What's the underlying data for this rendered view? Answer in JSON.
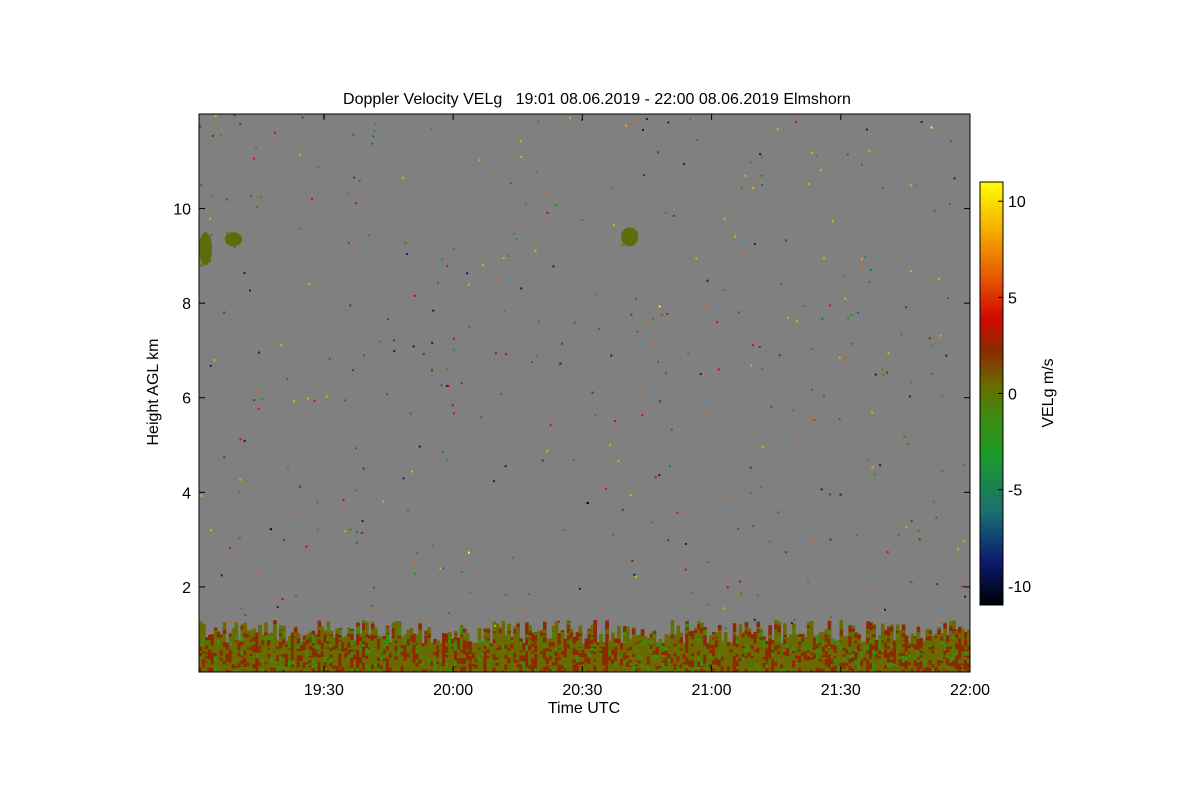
{
  "chart_data": {
    "type": "heatmap",
    "title": "Doppler Velocity VELg   19:01 08.06.2019 - 22:00 08.06.2019 Elmshorn",
    "xlabel": "Time UTC",
    "ylabel": "Height AGL km",
    "x_time_range": [
      "19:01",
      "22:00"
    ],
    "xticks": [
      "19:30",
      "20:00",
      "20:30",
      "21:00",
      "21:30",
      "22:00"
    ],
    "xtick_minutes": [
      30,
      60,
      90,
      120,
      150,
      180
    ],
    "ylim": [
      0.2,
      12.0
    ],
    "yticks": [
      2,
      4,
      6,
      8,
      10
    ],
    "colorbar": {
      "label": "VELg m/s",
      "range": [
        -11,
        11
      ],
      "ticks": [
        10,
        5,
        0,
        -5,
        -10
      ],
      "colors": [
        "#000000",
        "#0a1a6e",
        "#1b6e72",
        "#1a9a2a",
        "#3f8a10",
        "#6a6a00",
        "#8b2a00",
        "#d20a00",
        "#e85c00",
        "#f5a800",
        "#ffff00"
      ]
    },
    "background_color": "#808080",
    "features": [
      {
        "name": "boundary layer",
        "time_range": [
          "19:01",
          "22:00"
        ],
        "height_km": [
          0.2,
          1.3
        ],
        "velocity_m_s": [
          -2,
          3
        ]
      },
      {
        "name": "upper cloud",
        "time_range": [
          "19:01",
          "19:04"
        ],
        "height_km": [
          8.8,
          9.5
        ],
        "velocity_m_s": [
          -1,
          0
        ]
      },
      {
        "name": "upper cloud",
        "time_range": [
          "19:07",
          "19:11"
        ],
        "height_km": [
          9.2,
          9.5
        ],
        "velocity_m_s": [
          -1,
          0
        ]
      },
      {
        "name": "upper cloud",
        "time_range": [
          "20:39",
          "20:43"
        ],
        "height_km": [
          9.2,
          9.6
        ],
        "velocity_m_s": [
          -1,
          0
        ]
      }
    ]
  }
}
